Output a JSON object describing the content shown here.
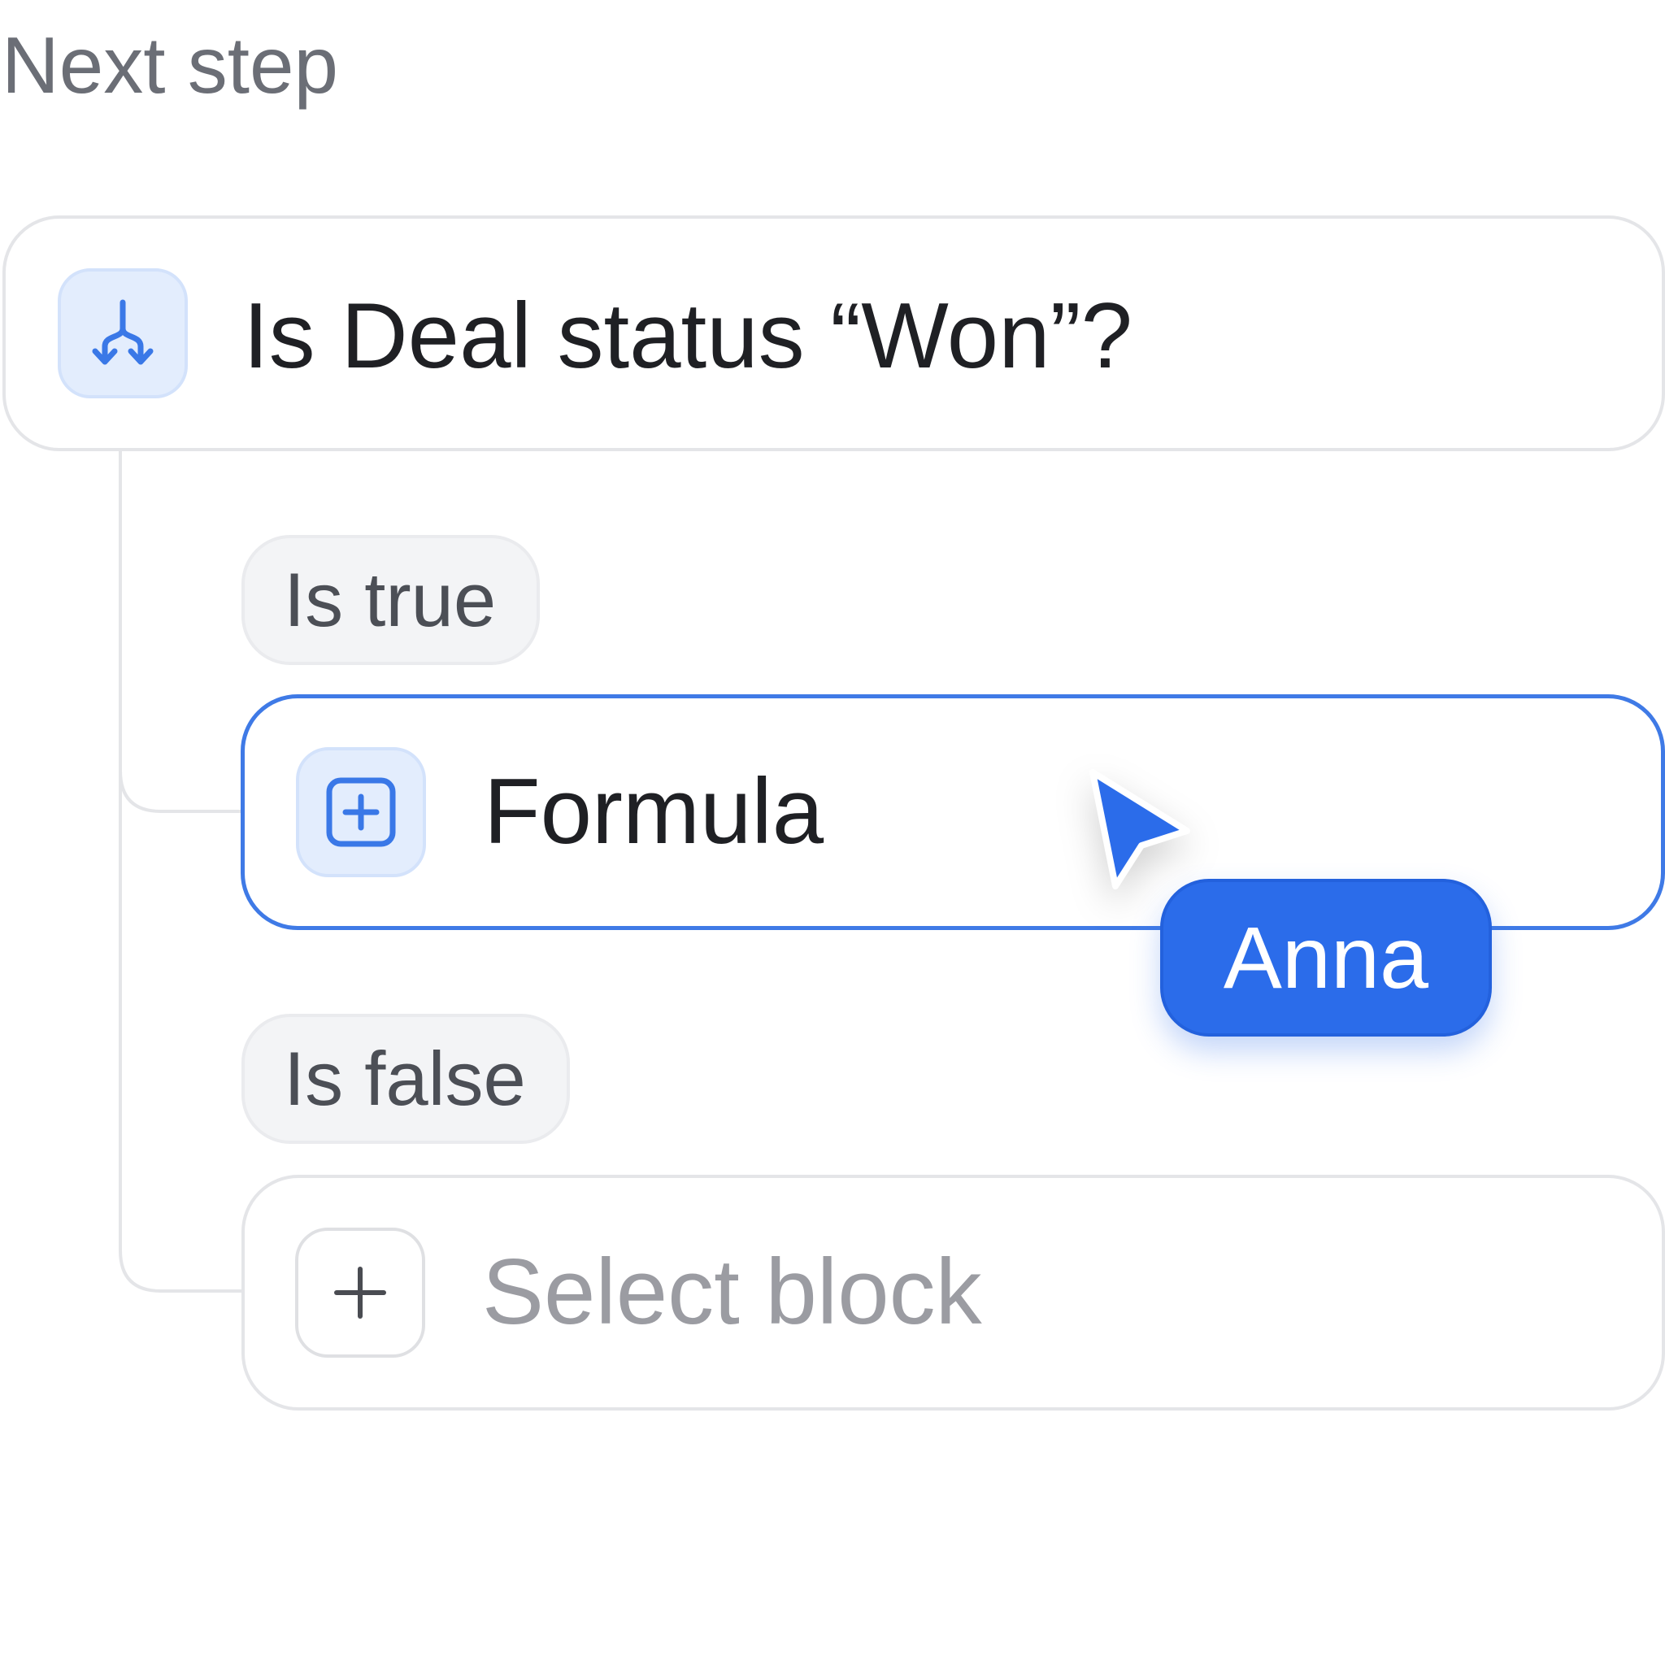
{
  "section": {
    "title": "Next step"
  },
  "condition_card": {
    "icon": "branch-split-icon",
    "text": "Is Deal status “Won”?"
  },
  "branches": {
    "true_label": "Is true",
    "false_label": "Is false"
  },
  "formula_card": {
    "icon": "plus-square-icon",
    "text": "Formula",
    "selected": true
  },
  "select_card": {
    "icon": "plus-icon",
    "placeholder": "Select block"
  },
  "collaborator": {
    "icon": "cursor-arrow-icon",
    "name": "Anna"
  },
  "colors": {
    "accent": "#2b6cea",
    "selected_border": "#3f7ae6",
    "icon_background": "#e3edfd",
    "border": "#e4e5e8",
    "pill_background": "#f3f4f6",
    "placeholder_text": "#9b9ca2",
    "title_text": "#6b6e76"
  }
}
